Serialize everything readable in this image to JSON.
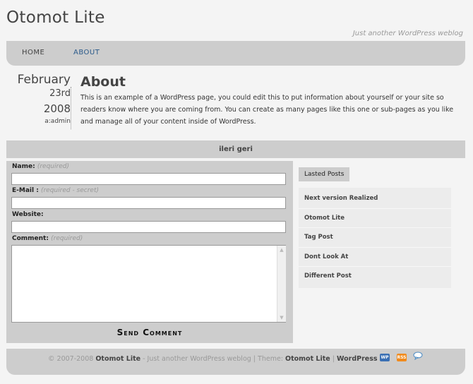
{
  "site": {
    "title": "Otomot Lite",
    "tagline": "Just another WordPress weblog"
  },
  "nav": {
    "items": [
      {
        "label": "HOME"
      },
      {
        "label": "ABOUT"
      }
    ]
  },
  "post": {
    "date": {
      "month": "February",
      "day": "23rd",
      "year": "2008",
      "author": "a:admin"
    },
    "title": "About",
    "body": "This is an example of a WordPress page, you could edit this to put information about yourself or your site so readers know where you are coming from. You can create as many pages like this one or sub-pages as you like and manage all of your content inside of WordPress."
  },
  "pager": {
    "label": "ileri geri"
  },
  "comment_form": {
    "name": {
      "label": "Name:",
      "hint": "(required)",
      "value": ""
    },
    "email": {
      "label": "E-Mail :",
      "hint": "(required - secret)",
      "value": ""
    },
    "website": {
      "label": "Website:",
      "value": ""
    },
    "comment": {
      "label": "Comment:",
      "hint": "(required)",
      "value": ""
    },
    "submit_label": "Send Comment"
  },
  "sidebar": {
    "tab_label": "Lasted Posts",
    "posts": [
      {
        "title": "Next version Realized"
      },
      {
        "title": "Otomot Lite"
      },
      {
        "title": "Tag Post"
      },
      {
        "title": "Dont Look At"
      },
      {
        "title": "Different Post"
      }
    ]
  },
  "footer": {
    "copyright": "© 2007-2008",
    "site_name": "Otomot Lite",
    "tagline_part": " - Just another WordPress weblog | Theme: ",
    "theme_name": "Otomot Lite",
    "separator": " | ",
    "powered_by": "WordPress",
    "icons": [
      "wordpress-icon",
      "rss-icon",
      "comments-icon"
    ]
  },
  "colors": {
    "background": "#f4f4f4",
    "panel": "#cdcdcd",
    "link_active": "#2a5a8a"
  }
}
